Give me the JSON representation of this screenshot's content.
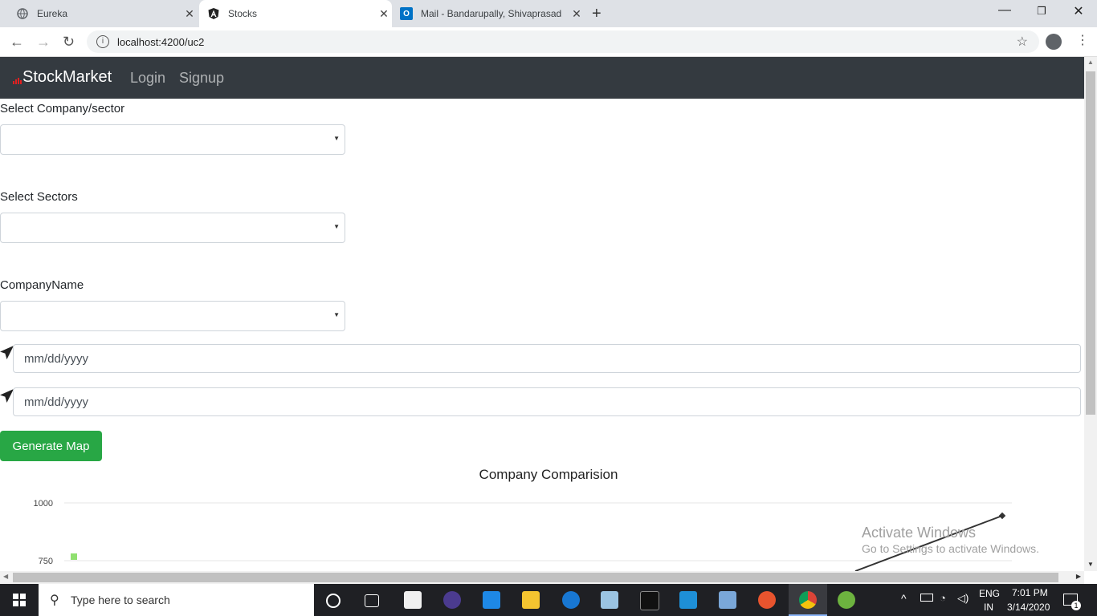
{
  "browser": {
    "tabs": [
      {
        "title": "Eureka",
        "active": false
      },
      {
        "title": "Stocks",
        "active": true
      },
      {
        "title": "Mail - Bandarupally, Shivaprasad",
        "active": false
      }
    ],
    "url": "localhost:4200/uc2"
  },
  "navbar": {
    "brand": "StockMarket",
    "links": [
      "Login",
      "Signup"
    ]
  },
  "form": {
    "company_sector_label": "Select Company/sector",
    "sectors_label": "Select Sectors",
    "company_name_label": "CompanyName",
    "from_date_placeholder": "mm/dd/yyyy",
    "to_date_placeholder": "mm/dd/yyyy",
    "generate_button": "Generate Map"
  },
  "chart_data": {
    "type": "line",
    "title": "Company Comparision",
    "y_ticks": [
      "1000",
      "750"
    ]
  },
  "os": {
    "activation_title": "Activate Windows",
    "activation_sub": "Go to Settings to activate Windows.",
    "search_placeholder": "Type here to search",
    "lang": "ENG",
    "region": "IN",
    "time": "7:01 PM",
    "date": "3/14/2020",
    "notification_count": "1"
  },
  "colors": {
    "navbar": "#343a40",
    "button": "#28a745",
    "taskbar": "#1f2024"
  }
}
